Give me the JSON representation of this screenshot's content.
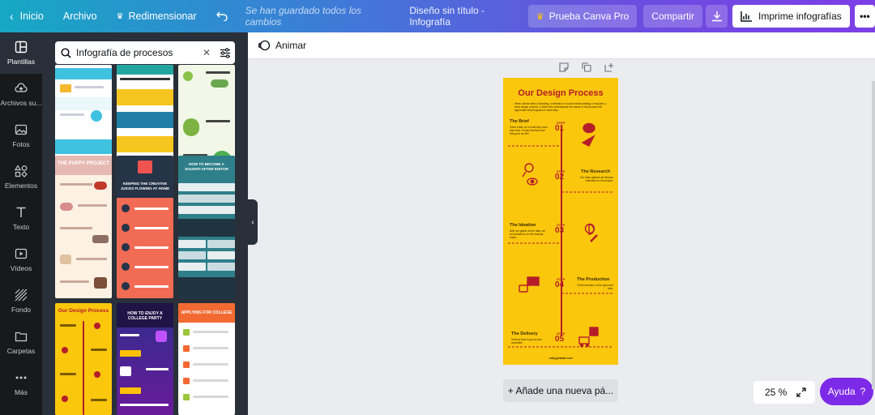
{
  "topbar": {
    "home_label": "Inicio",
    "file_label": "Archivo",
    "resize_label": "Redimensionar",
    "saved_status": "Se han guardado todos los cambios",
    "doc_title": "Diseño sin título - Infografía",
    "pro_label": "Prueba Canva Pro",
    "share_label": "Compartir",
    "print_label": "Imprime infografías"
  },
  "rail": {
    "items": [
      {
        "label": "Plantillas",
        "icon": "layout-icon"
      },
      {
        "label": "Archivos su...",
        "icon": "upload-cloud-icon"
      },
      {
        "label": "Fotos",
        "icon": "image-icon"
      },
      {
        "label": "Elementos",
        "icon": "shapes-icon"
      },
      {
        "label": "Texto",
        "icon": "text-icon"
      },
      {
        "label": "Vídeos",
        "icon": "video-icon"
      },
      {
        "label": "Fondo",
        "icon": "pattern-icon"
      },
      {
        "label": "Carpetas",
        "icon": "folder-icon"
      },
      {
        "label": "Más",
        "icon": "more-dots-icon"
      }
    ]
  },
  "panel": {
    "search_value": "Infografía de procesos",
    "templates": [
      {
        "title": ""
      },
      {
        "title": ""
      },
      {
        "title": ""
      },
      {
        "title": "THE PUPPY PROJECT"
      },
      {
        "title": "KEEPING THE CREATIVE JUICES FLOWING AT HOME"
      },
      {
        "title": "HOW TO BECOME A SOUGHT-AFTER EDITOR"
      },
      {
        "title": "Our Design Process"
      },
      {
        "title": "HOW TO ENJOY A COLLEGE PARTY"
      },
      {
        "title": "APPLYING FOR COLLEGE"
      }
    ]
  },
  "editor": {
    "animate_label": "Animar",
    "add_page_label": "+ Añade una nueva pá...",
    "zoom_label": "25 %",
    "help_label": "Ayuda",
    "help_mark": "?"
  },
  "design": {
    "title": "Our Design Process",
    "intro": "When clients need a branding, a website or a social media strategy, it requires a clear design process. A client who understands the basics of the process will appreciate what happens in each step.",
    "step_word": "STEP",
    "stages": [
      {
        "name": "The Brief",
        "num": "01",
        "desc": "Client briefs us of what they want and need. Project timelines are being set as well."
      },
      {
        "name": "The Research",
        "num": "02",
        "desc": "Our team gathers all relevant materials for the project."
      },
      {
        "name": "The Ideation",
        "num": "03",
        "desc": "After we gather all the data, we do brainstorm on the drawing board."
      },
      {
        "name": "The Production",
        "num": "04",
        "desc": "Final execution of the approved idea."
      },
      {
        "name": "The Delivery",
        "num": "05",
        "desc": "Delivery time is gonna and celebrate!"
      }
    ],
    "footer": "reallygreatsite.com"
  },
  "colors": {
    "canva_purple": "#7d2ae8",
    "design_yellow": "#fbc70d",
    "design_red": "#b51e29"
  }
}
